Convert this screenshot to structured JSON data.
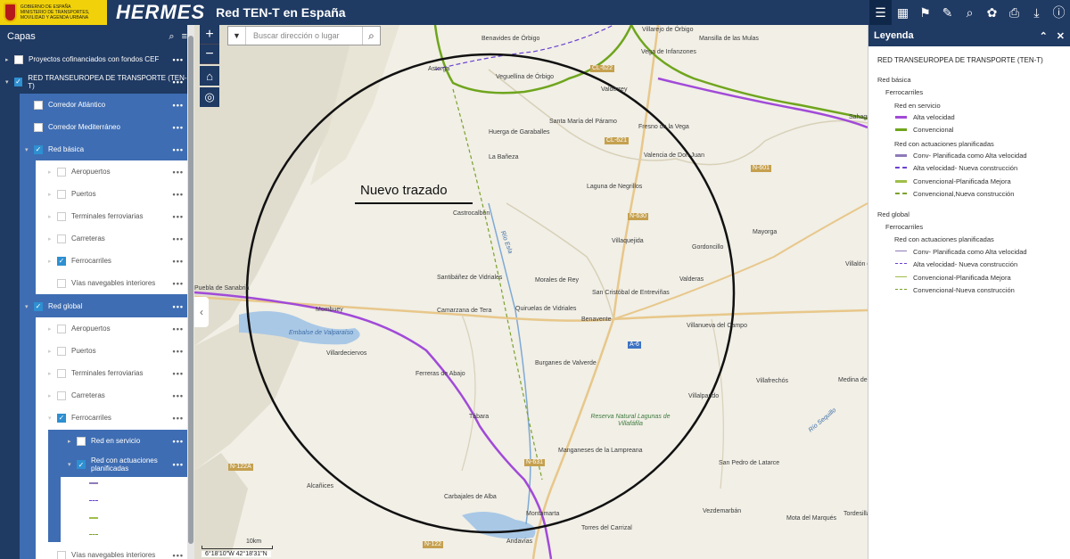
{
  "header": {
    "gov_logo_text": [
      "GOBIERNO DE ESPAÑA",
      "MINISTERIO DE TRANSPORTES, MOVILIDAD Y AGENDA URBANA"
    ],
    "app_logo": "HERMES",
    "app_title": "Red TEN-T en España",
    "tools": [
      "list-icon",
      "grid-icon",
      "bookmark-icon",
      "measure-icon",
      "search-zoom-icon",
      "palette-icon",
      "print-icon",
      "download-icon",
      "info-icon"
    ]
  },
  "layers": {
    "title": "Capas",
    "items": [
      {
        "label": "Proyectos cofinanciados con fondos CEF",
        "checked": false
      },
      {
        "label": "RED TRANSEUROPEA DE TRANSPORTE (TEN-T)",
        "checked": true
      },
      {
        "label": "Corredor Atlántico",
        "checked": false
      },
      {
        "label": "Corredor Mediterráneo",
        "checked": false
      },
      {
        "label": "Red básica",
        "checked": true
      },
      {
        "label": "Aeropuertos",
        "checked": false
      },
      {
        "label": "Puertos",
        "checked": false
      },
      {
        "label": "Terminales ferroviarias",
        "checked": false
      },
      {
        "label": "Carreteras",
        "checked": false
      },
      {
        "label": "Ferrocarriles",
        "checked": true
      },
      {
        "label": "Vías navegables interiores",
        "checked": false
      },
      {
        "label": "Red global",
        "checked": true
      },
      {
        "label": "Aeropuertos",
        "checked": false
      },
      {
        "label": "Puertos",
        "checked": false
      },
      {
        "label": "Terminales ferroviarias",
        "checked": false
      },
      {
        "label": "Carreteras",
        "checked": false
      },
      {
        "label": "Ferrocarriles",
        "checked": true
      },
      {
        "label": "Red en servicio",
        "checked": false
      },
      {
        "label": "Red con actuaciones planificadas",
        "checked": true
      },
      {
        "label": "Vías navegables interiores",
        "checked": false
      }
    ]
  },
  "map": {
    "search_placeholder": "Buscar dirección o lugar",
    "annotation": "Nuevo trazado",
    "scale_label": "10km",
    "coords": "6°18'10\"W 42°18'31\"N",
    "places": [
      "Benavides de Órbigo",
      "Villarejo de Órbigo",
      "Astorga",
      "Veguellina de Órbigo",
      "Valderrey",
      "Huerga de Garaballes",
      "Santa María del Páramo",
      "Fresno de la Vega",
      "Valencia de Don Juan",
      "Mansilla de las Mulas",
      "Vega de Infanzones",
      "La Bañeza",
      "Laguna de Negrillos",
      "Castrocalbón",
      "Villaquejida",
      "Gordoncillo",
      "Mayorga",
      "Villalón de Campos",
      "Santibáñez de Vidriales",
      "Morales de Rey",
      "San Cristóbal de Entreviñas",
      "Valderas",
      "Mombuey",
      "Camarzana de Tera",
      "Quiruelas de Vidriales",
      "Benavente",
      "Villanueva del Campo",
      "Puebla de Sanabria",
      "Villardeciervos",
      "Ferreras de Abajo",
      "Burganes de Valverde",
      "Villafrechós",
      "Medina de Rioseco",
      "Villalpando",
      "Tábara",
      "Manganeses de la Lampreana",
      "San Pedro de Latarce",
      "Alcañices",
      "Carbajales de Alba",
      "Montamarta",
      "Andavías",
      "Torres del Carrizal",
      "Vezdemarbán",
      "Mota del Marqués",
      "Tordesillas",
      "Sahagún"
    ],
    "water": [
      "Embalse de Valparaíso",
      "Río Esla",
      "Río Sequillo"
    ],
    "park": "Reserva Natural Lagunas de Villafáfila",
    "roads": [
      "CL-622",
      "CL-621",
      "N-601",
      "N-630",
      "A-6",
      "N-122A",
      "N-631",
      "N-122"
    ]
  },
  "legend": {
    "title": "Leyenda",
    "layer_title": "RED TRANSEUROPEA DE TRANSPORTE (TEN-T)",
    "basic": "Red básica",
    "basic_rail": "Ferrocarriles",
    "service": "Red en servicio",
    "high_speed": "Alta velocidad",
    "conventional": "Convencional",
    "planned": "Red con actuaciones planificadas",
    "planned_items": [
      "Conv- Planificada como Alta velocidad",
      "Alta velocidad- Nueva construcción",
      "Convencional-Planificada Mejora",
      "Convencional,Nueva construcción"
    ],
    "global": "Red global",
    "global_rail": "Ferrocarriles",
    "global_planned": "Red con actuaciones planificadas",
    "global_items": [
      "Conv- Planificada como Alta velocidad",
      "Alta velocidad- Nueva construcción",
      "Convencional-Planificada Mejora",
      "Convencional-Nueva construcción"
    ],
    "colors": {
      "high_speed": "#a14ad8",
      "conventional": "#6fa51d",
      "planned_hs": "#8e7bb8",
      "new_hs": "#6b3fd1",
      "planned_improve": "#9fbe4a",
      "new_conv": "#7aa12a"
    }
  }
}
